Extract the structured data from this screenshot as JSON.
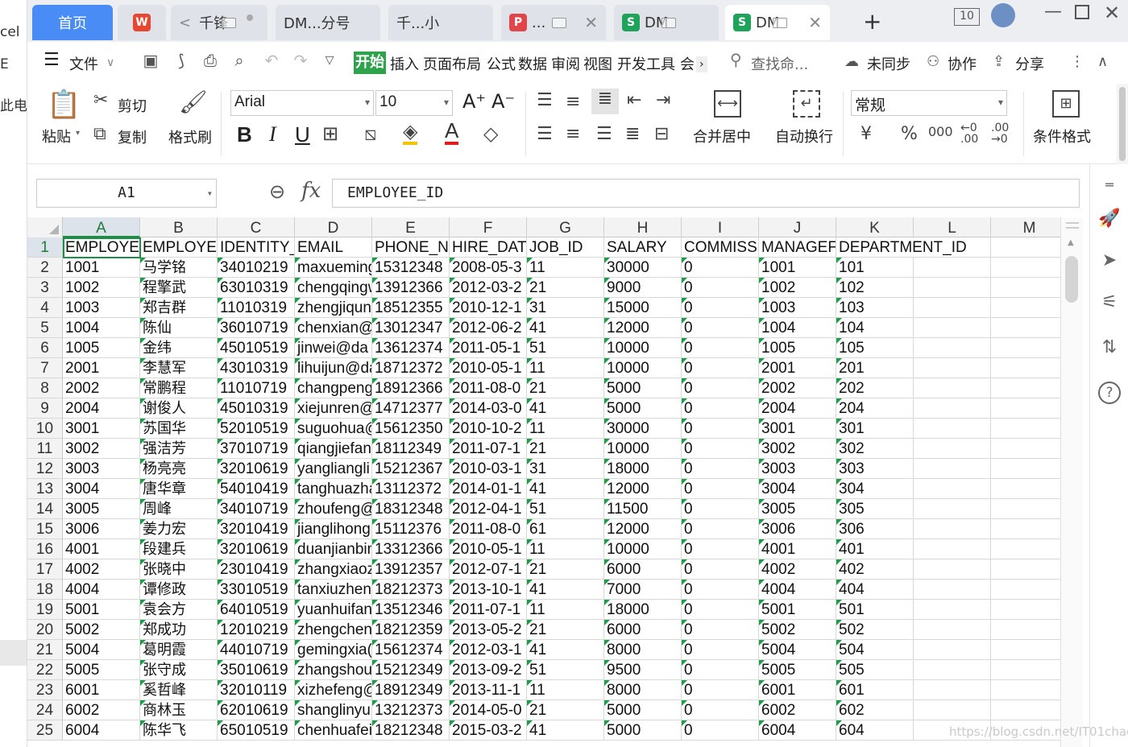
{
  "left_panel": {
    "texts": [
      "cel",
      "E",
      "此电"
    ]
  },
  "tabs": [
    {
      "label": "首页",
      "type": "home"
    },
    {
      "label": "",
      "icon": "wps-logo",
      "type": "icon-only"
    },
    {
      "label": "千锋",
      "type": "doc"
    },
    {
      "label": "DM...分号",
      "type": "doc"
    },
    {
      "label": "千...小",
      "type": "doc"
    },
    {
      "label": "...",
      "icon": "pdf-icon",
      "type": "doc"
    },
    {
      "label": "DM",
      "icon": "sheet-icon",
      "type": "doc"
    },
    {
      "label": "DM",
      "icon": "sheet-icon",
      "type": "active"
    }
  ],
  "tab_icons": {
    "wps": "W",
    "pdf": "P",
    "sheet": "S"
  },
  "topbar": {
    "count_badge": "10",
    "add_tab": "+"
  },
  "menu": {
    "file": "文件",
    "start": "开始",
    "items": [
      "插入",
      "页面布局",
      "公式",
      "数据",
      "审阅",
      "视图",
      "开发工具",
      "会"
    ],
    "search_placeholder": "查找命...",
    "unsynced": "未同步",
    "collab": "协作",
    "share": "分享"
  },
  "ribbon": {
    "paste": "粘贴",
    "cut": "剪切",
    "copy": "复制",
    "format_painter": "格式刷",
    "font_name": "Arial",
    "font_size": "10",
    "merge_center": "合并居中",
    "auto_wrap": "自动换行",
    "number_format": "常规",
    "cond_format": "条件格式",
    "currency": "¥",
    "percent": "%",
    "thousands": "000",
    "bold": "B",
    "italic": "I",
    "underline": "U"
  },
  "formula_bar": {
    "name_box": "A1",
    "fx": "fx",
    "content": "EMPLOYEE_ID"
  },
  "grid": {
    "columns": [
      "A",
      "B",
      "C",
      "D",
      "E",
      "F",
      "G",
      "H",
      "I",
      "J",
      "K",
      "L",
      "M"
    ],
    "rows": [
      [
        "EMPLOYE",
        "EMPLOYE",
        "IDENTITY_",
        "EMAIL",
        "PHONE_N",
        "HIRE_DAT",
        "JOB_ID",
        "SALARY",
        "COMMISS",
        "MANAGEF",
        "DEPARTMENT_ID",
        ""
      ],
      [
        "1001",
        "马学铭",
        "34010219",
        "maxueming",
        "15312348",
        "2008-05-3",
        "11",
        "30000",
        "0",
        "1001",
        "101",
        ""
      ],
      [
        "1002",
        "程擎武",
        "63010319",
        "chengqingw",
        "13912366",
        "2012-03-2",
        "21",
        "9000",
        "0",
        "1002",
        "102",
        ""
      ],
      [
        "1003",
        "郑吉群",
        "11010319",
        "zhengjiqun",
        "18512355",
        "2010-12-1",
        "31",
        "15000",
        "0",
        "1003",
        "103",
        ""
      ],
      [
        "1004",
        "陈仙",
        "36010719",
        "chenxian@",
        "13012347",
        "2012-06-2",
        "41",
        "12000",
        "0",
        "1004",
        "104",
        ""
      ],
      [
        "1005",
        "金纬",
        "45010519",
        "jinwei@da",
        "13612374",
        "2011-05-1",
        "51",
        "10000",
        "0",
        "1005",
        "105",
        ""
      ],
      [
        "2001",
        "李慧军",
        "43010319",
        "lihuijun@da",
        "18712372",
        "2010-05-1",
        "11",
        "10000",
        "0",
        "2001",
        "201",
        ""
      ],
      [
        "2002",
        "常鹏程",
        "11010719",
        "changpeng",
        "18912366",
        "2011-08-0",
        "21",
        "5000",
        "0",
        "2002",
        "202",
        ""
      ],
      [
        "2004",
        "谢俊人",
        "45010319",
        "xiejunren@",
        "14712377",
        "2014-03-0",
        "41",
        "5000",
        "0",
        "2004",
        "204",
        ""
      ],
      [
        "3001",
        "苏国华",
        "52010519",
        "suguohua@",
        "15612350",
        "2010-10-2",
        "11",
        "30000",
        "0",
        "3001",
        "301",
        ""
      ],
      [
        "3002",
        "强洁芳",
        "37010719",
        "qiangjiefan",
        "18112349",
        "2011-07-1",
        "21",
        "10000",
        "0",
        "3002",
        "302",
        ""
      ],
      [
        "3003",
        "杨亮亮",
        "32010619",
        "yangliangli",
        "15212367",
        "2010-03-1",
        "31",
        "18000",
        "0",
        "3003",
        "303",
        ""
      ],
      [
        "3004",
        "唐华章",
        "54010419",
        "tanghuazha",
        "13112372",
        "2014-01-1",
        "41",
        "12000",
        "0",
        "3004",
        "304",
        ""
      ],
      [
        "3005",
        "周峰",
        "34010719",
        "zhoufeng@",
        "18312348",
        "2012-04-1",
        "51",
        "11500",
        "0",
        "3005",
        "305",
        ""
      ],
      [
        "3006",
        "姜力宏",
        "32010419",
        "jianglihong",
        "15112376",
        "2011-08-0",
        "61",
        "12000",
        "0",
        "3006",
        "306",
        ""
      ],
      [
        "4001",
        "段建兵",
        "32010619",
        "duanjianbin",
        "13312366",
        "2010-05-1",
        "11",
        "10000",
        "0",
        "4001",
        "401",
        ""
      ],
      [
        "4002",
        "张晓中",
        "23010419",
        "zhangxiaoz",
        "13912357",
        "2012-07-1",
        "21",
        "6000",
        "0",
        "4002",
        "402",
        ""
      ],
      [
        "4004",
        "谭修政",
        "33010519",
        "tanxiuzhen",
        "18212373",
        "2013-10-1",
        "41",
        "7000",
        "0",
        "4004",
        "404",
        ""
      ],
      [
        "5001",
        "袁会方",
        "64010519",
        "yuanhuifan",
        "13512346",
        "2011-07-1",
        "11",
        "18000",
        "0",
        "5001",
        "501",
        ""
      ],
      [
        "5002",
        "郑成功",
        "12010219",
        "zhengchen",
        "18212359",
        "2013-05-2",
        "21",
        "6000",
        "0",
        "5002",
        "502",
        ""
      ],
      [
        "5004",
        "葛明霞",
        "44010719",
        "gemingxia(",
        "15612374",
        "2012-03-1",
        "41",
        "8000",
        "0",
        "5004",
        "504",
        ""
      ],
      [
        "5005",
        "张守成",
        "35010619",
        "zhangshou",
        "15212349",
        "2013-09-2",
        "51",
        "9500",
        "0",
        "5005",
        "505",
        ""
      ],
      [
        "6001",
        "奚哲峰",
        "32010119",
        "xizhefeng@",
        "18912349",
        "2013-11-1",
        "11",
        "8000",
        "0",
        "6001",
        "601",
        ""
      ],
      [
        "6002",
        "商林玉",
        "62010619",
        "shanglinyu",
        "13212373",
        "2014-05-0",
        "21",
        "5000",
        "0",
        "6002",
        "602",
        ""
      ],
      [
        "6004",
        "陈华飞",
        "65010519",
        "chenhuafei",
        "18212348",
        "2015-03-2",
        "41",
        "5000",
        "0",
        "6004",
        "604",
        ""
      ]
    ]
  },
  "watermark": "https://blog.csdn.net/IT01chao"
}
